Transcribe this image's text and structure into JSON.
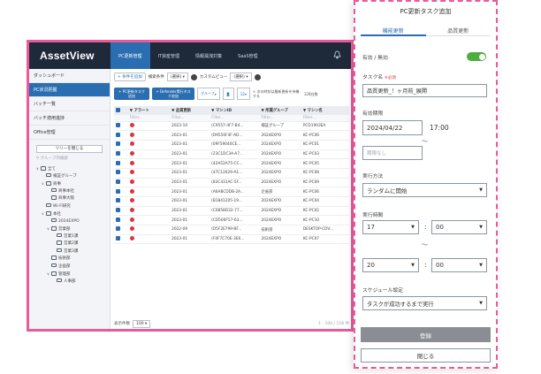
{
  "app": {
    "logo_text": "AssetView",
    "nav_tabs": [
      "PC更新管理",
      "IT資産管理",
      "情報漏洩対策",
      "SaaS管理"
    ]
  },
  "sidebar": {
    "items": [
      "ダッシュボード",
      "PC状況把握",
      "バッチ一覧",
      "バッチ適用進捗",
      "Office管理"
    ],
    "tree_button": "ツリーを閉じる",
    "tree_search_placeholder": "グループ内検索",
    "tree": [
      {
        "label": "全て",
        "level": 0,
        "expanded": true
      },
      {
        "label": "検証グループ",
        "level": 1
      },
      {
        "label": "商事",
        "level": 1,
        "expanded": true
      },
      {
        "label": "商事本社",
        "level": 2
      },
      {
        "label": "商事大阪",
        "level": 2
      },
      {
        "label": "Wi-Fi研究",
        "level": 1
      },
      {
        "label": "本社",
        "level": 1,
        "expanded": true
      },
      {
        "label": "2024EXPO",
        "level": 2
      },
      {
        "label": "営業部",
        "level": 2,
        "expanded": true
      },
      {
        "label": "営業1課",
        "level": 3
      },
      {
        "label": "営業2課",
        "level": 3
      },
      {
        "label": "営業3課",
        "level": 3
      },
      {
        "label": "技術部",
        "level": 2
      },
      {
        "label": "企画部",
        "level": 2
      },
      {
        "label": "管理部",
        "level": 2,
        "expanded": true
      },
      {
        "label": "人事部",
        "level": 3
      }
    ]
  },
  "main": {
    "toolbar": {
      "add_condition": "+ 条件を追加",
      "search_label": "検索条件",
      "search_value": "(選択)",
      "custom_view_label": "カスタムビュー",
      "custom_view_value": "(選択)"
    },
    "actions": {
      "pc_update_task": "+ PC更新タスク追加",
      "defender_task": "+ Defender実行タスク追加",
      "group": "グループ",
      "per_page": "12",
      "note": "× 次の時刻は最新更新を待機する",
      "count": "128台数"
    },
    "columns": [
      "アラート",
      "品質更新",
      "マシンID",
      "所属グループ",
      "マシン名"
    ],
    "filter_placeholder": "Filter...",
    "rows": [
      [
        "2023-10",
        "(C9557-4F7-B4...",
        "検証グループ",
        "PCD1903EA"
      ],
      [
        "2023-01",
        "(D9550F4F-AD...",
        "2024EXPO",
        "KC-PC06"
      ],
      [
        "2023-01",
        "(09F59040CE...",
        "2024EXPO",
        "KC-PC01"
      ],
      [
        "2023-01",
        "(23C1DC3A-A7...",
        "2024EXPO",
        "KC-PC03"
      ],
      [
        "2023-01",
        "(42A52A75-CC...",
        "2024EXPO",
        "KC-PC05"
      ],
      [
        "2023-01",
        "(47C12629-A1...",
        "2024EXPO",
        "KC-PC08"
      ],
      [
        "2023-01",
        "(83C431AC-5F...",
        "2024EXPO",
        "KC-PC09"
      ],
      [
        "2023-01",
        "(A6ABCDDB-2A...",
        "企画部",
        "KC-PC06"
      ],
      [
        "2023-01",
        "(B1841205-19...",
        "2024EXPO",
        "KC-PC04"
      ],
      [
        "2023-01",
        "(C6858D32-77...",
        "2024EXPO",
        "KC-PC02"
      ],
      [
        "2023-01",
        "(CD500F57-63...",
        "2024EXPO",
        "KC-PC10"
      ],
      [
        "2022-09",
        "(D5F2E799-BF...",
        "技術部",
        "DESKTOP-CDV..."
      ],
      [
        "2023-01",
        "(F0F7C70E-3E6...",
        "2024EXPO",
        "KC-PC07"
      ]
    ],
    "footer": {
      "per_page_label": "表示件数",
      "per_page_value": "100",
      "pager": "1 - 100 / 128 件"
    }
  },
  "dialog": {
    "title": "PC更新タスク追加",
    "tabs": [
      "機能更新",
      "品質更新"
    ],
    "enabled_label": "有効 / 無効",
    "enabled": true,
    "task_name_label": "タスク名",
    "required": "※必須",
    "task_name_value": "品質更新_！ヶ月前_展開",
    "period_label": "有効期限",
    "date_value": "2024/04/22",
    "time_value": "17:00",
    "tilde": "〜",
    "no_limit_placeholder": "期限なし",
    "exec_method_label": "実行方法",
    "exec_method_value": "ランダムに開始",
    "exec_time_label": "実行時間",
    "start_hour": "17",
    "start_min": "00",
    "end_hour": "20",
    "end_min": "00",
    "colon": ":",
    "schedule_label": "スケジュール設定",
    "schedule_value": "タスクが成功するまで実行",
    "register_button": "登録",
    "close_button": "閉じる"
  },
  "colors": {
    "highlight_border": "#e85b9a",
    "topbar": "#1e2a3a",
    "accent": "#2a6db0",
    "toggle_on": "#4caf3d",
    "alert": "#d9363e"
  }
}
